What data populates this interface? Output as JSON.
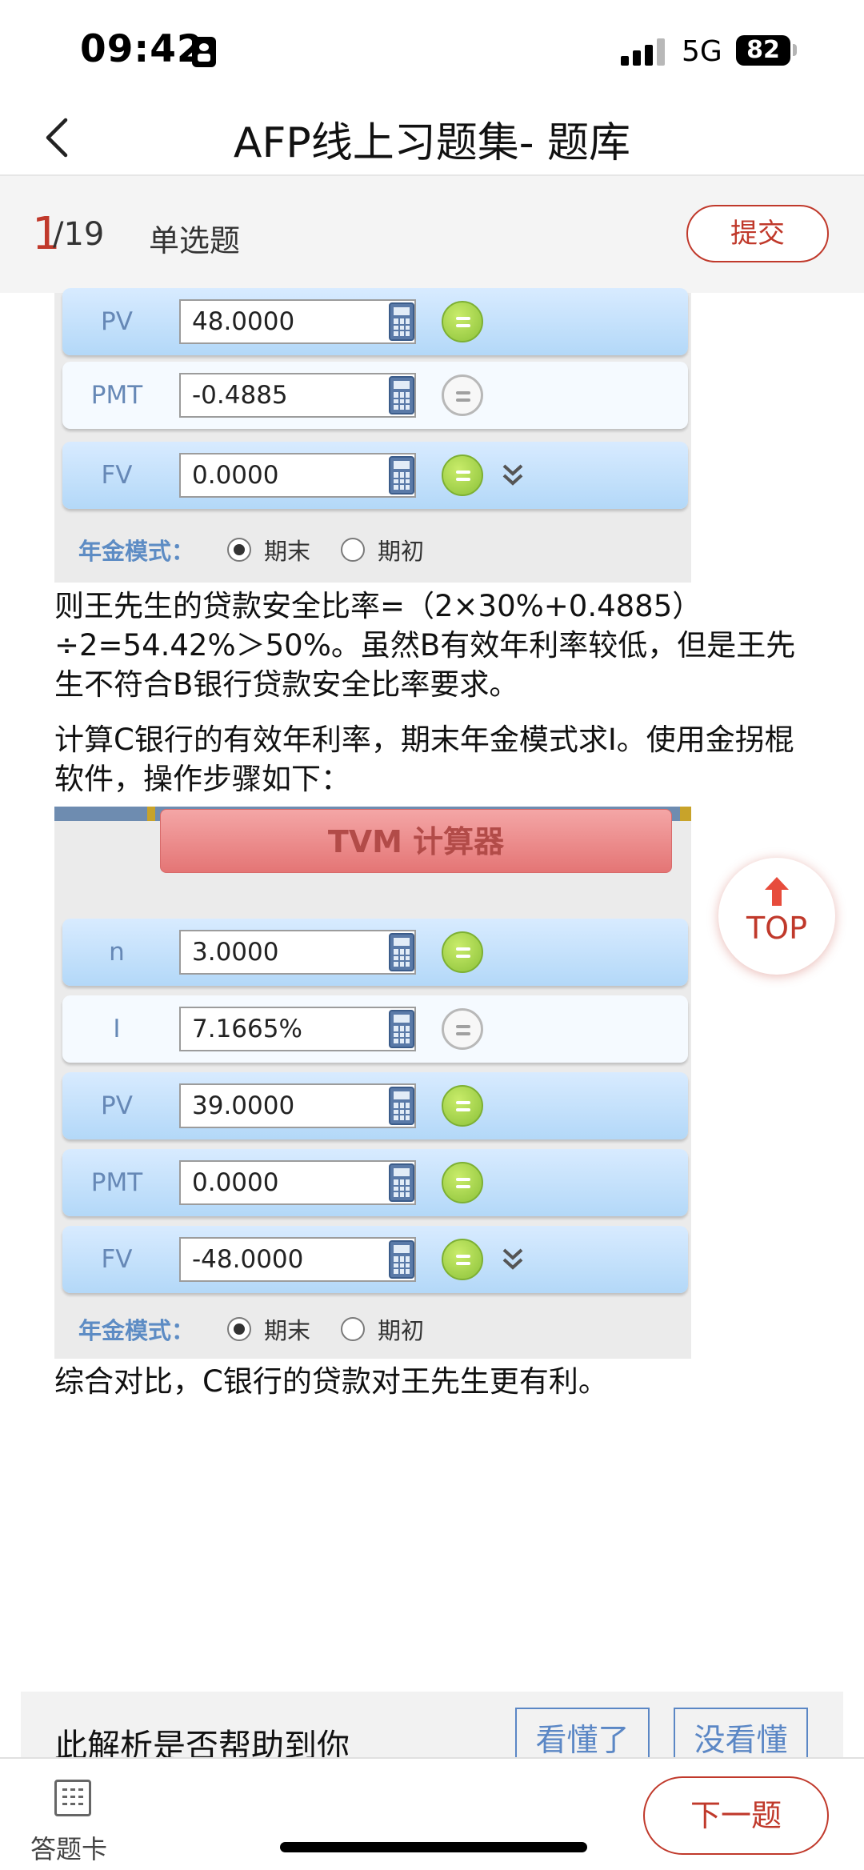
{
  "status_bar": {
    "time": "09:42",
    "network": "5G",
    "battery": "82"
  },
  "nav": {
    "title": "AFP线上习题集- 题库"
  },
  "question": {
    "current": "1",
    "total": "/19",
    "type": "单选题",
    "submit_label": "提交"
  },
  "calc1": {
    "rows": [
      {
        "label": "PV",
        "value": "48.0000",
        "solve_active": true
      },
      {
        "label": "PMT",
        "value": "-0.4885",
        "solve_active": false
      },
      {
        "label": "FV",
        "value": "0.0000",
        "solve_active": true
      }
    ],
    "mode_label": "年金模式：",
    "mode_end": "期末",
    "mode_begin": "期初",
    "mode_selected": "期末"
  },
  "paragraph1": "则王先生的贷款安全比率=（2×30%+0.4885）÷2=54.42%＞50%。虽然B有效年利率较低，但是王先生不符合B银行贷款安全比率要求。",
  "paragraph2": "计算C银行的有效年利率，期末年金模式求I。使用金拐棍软件，操作步骤如下：",
  "calc2": {
    "title": "TVM 计算器",
    "rows": [
      {
        "label": "n",
        "value": "3.0000",
        "solve_active": true
      },
      {
        "label": "I",
        "value": "7.1665%",
        "solve_active": false
      },
      {
        "label": "PV",
        "value": "39.0000",
        "solve_active": true
      },
      {
        "label": "PMT",
        "value": "0.0000",
        "solve_active": true
      },
      {
        "label": "FV",
        "value": "-48.0000",
        "solve_active": true
      }
    ],
    "mode_label": "年金模式：",
    "mode_end": "期末",
    "mode_begin": "期初",
    "mode_selected": "期末"
  },
  "paragraph3": "综合对比，C银行的贷款对王先生更有利。",
  "top_button": {
    "label": "TOP"
  },
  "feedback": {
    "question": "此解析是否帮助到你",
    "yes_label": "看懂了",
    "no_label": "没看懂"
  },
  "bottom": {
    "answer_card_label": "答题卡",
    "next_label": "下一题"
  },
  "colors": {
    "accent": "#c0392b",
    "link_blue": "#5b87c5",
    "solve_green": "#8cc23a"
  }
}
